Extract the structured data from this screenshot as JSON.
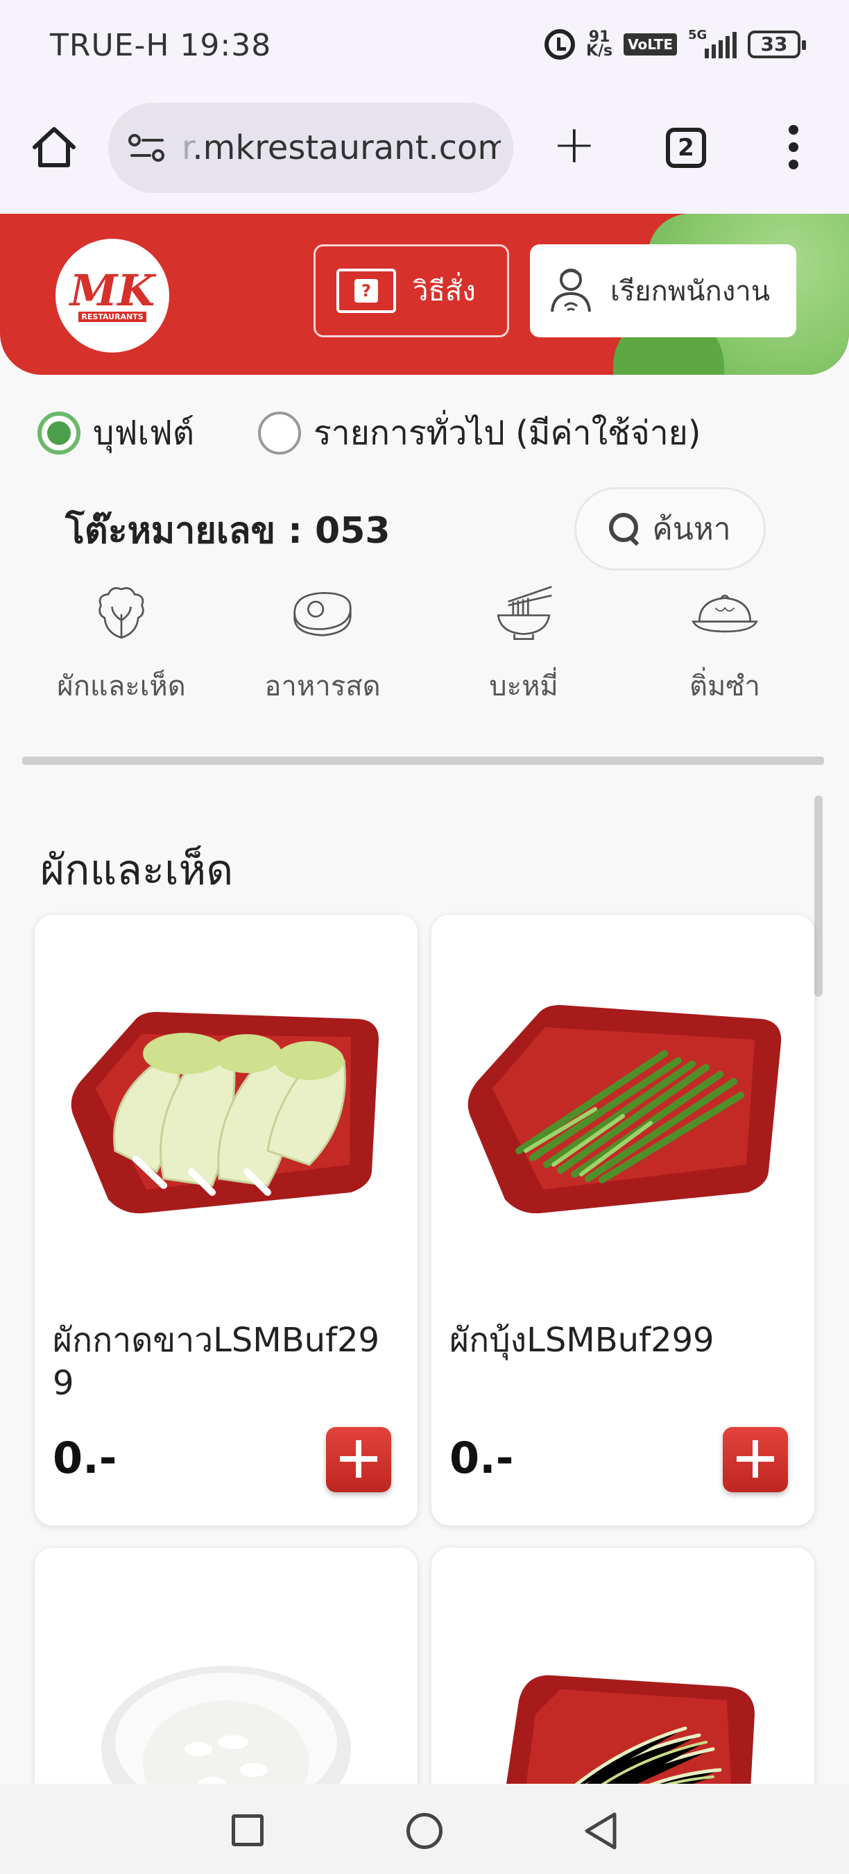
{
  "status_bar": {
    "carrier_time": "TRUE-H 19:38",
    "net_speed_value": "91",
    "net_speed_unit": "K/s",
    "volte": "VoLTE",
    "network": "5G",
    "battery": "33"
  },
  "browser": {
    "url_faded": "r",
    "url": ".mkrestaurant.com",
    "tab_count": "2"
  },
  "header": {
    "logo_text": "MK",
    "logo_sub": "RESTAURANTS",
    "howto_label": "วิธีสั่ง",
    "howto_icon_glyph": "?",
    "call_staff_label": "เรียกพนักงาน"
  },
  "filters": {
    "buffet": "บุฟเฟต์",
    "general": "รายการทั่วไป (มีค่าใช้จ่าย)",
    "selected": "buffet"
  },
  "table_label": "โต๊ะหมายเลข : 053",
  "search_label": "ค้นหา",
  "categories": [
    {
      "label": "ผักและเห็ด",
      "icon": "vegetable-icon"
    },
    {
      "label": "อาหารสด",
      "icon": "meat-icon"
    },
    {
      "label": "บะหมี่",
      "icon": "noodle-icon"
    },
    {
      "label": "ติ่มซำ",
      "icon": "dimsum-icon"
    }
  ],
  "section_title": "ผักและเห็ด",
  "products": [
    {
      "name": "ผักกาดขาวLSMBuf299",
      "price": "0.-",
      "image": "chinese-cabbage"
    },
    {
      "name": "ผักบุ้งLSMBuf299",
      "price": "0.-",
      "image": "morning-glory"
    },
    {
      "name": "",
      "price": "",
      "image": "rice-bowl"
    },
    {
      "name": "",
      "price": "",
      "image": "shredded-cabbage"
    }
  ]
}
